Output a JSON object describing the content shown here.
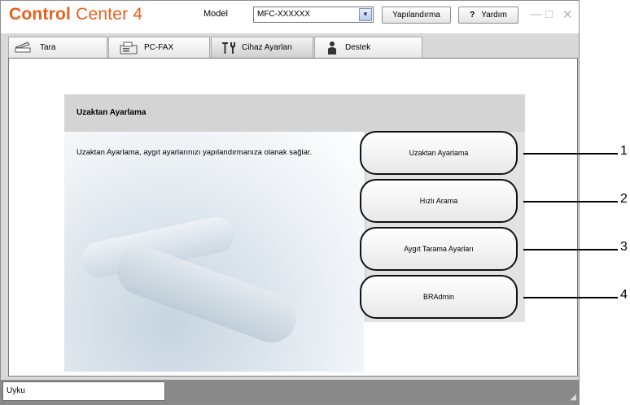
{
  "app": {
    "logo_bold": "Control",
    "logo_rest": "Center 4"
  },
  "header": {
    "model_label": "Model",
    "model_value": "MFC-XXXXXX",
    "configure_label": "Yapılandırma",
    "help_icon": "?",
    "help_label": "Yardım",
    "window_controls": {
      "minimize": "—",
      "maximize": "□",
      "close": "✕"
    }
  },
  "tabs": [
    {
      "label": "Tara",
      "icon": "scanner-icon"
    },
    {
      "label": "PC-FAX",
      "icon": "fax-icon"
    },
    {
      "label": "Cihaz Ayarları",
      "icon": "tools-icon",
      "active": true
    },
    {
      "label": "Destek",
      "icon": "person-icon"
    }
  ],
  "main": {
    "section_title": "Uzaktan Ayarlama",
    "description": "Uzaktan Ayarlama, aygıt ayarlarınızı yapılandırmanıza olanak sağlar.",
    "buttons": [
      {
        "label": "Uzaktan Ayarlama",
        "callout": "1"
      },
      {
        "label": "Hızlı Arama",
        "callout": "2"
      },
      {
        "label": "Aygıt Tarama Ayarları",
        "callout": "3"
      },
      {
        "label": "BRAdmin",
        "callout": "4"
      }
    ]
  },
  "status": {
    "text": "Uyku"
  },
  "colors": {
    "brand": "#e8601c",
    "frame": "#d9d9d9",
    "statusbar": "#8a8a8a"
  }
}
